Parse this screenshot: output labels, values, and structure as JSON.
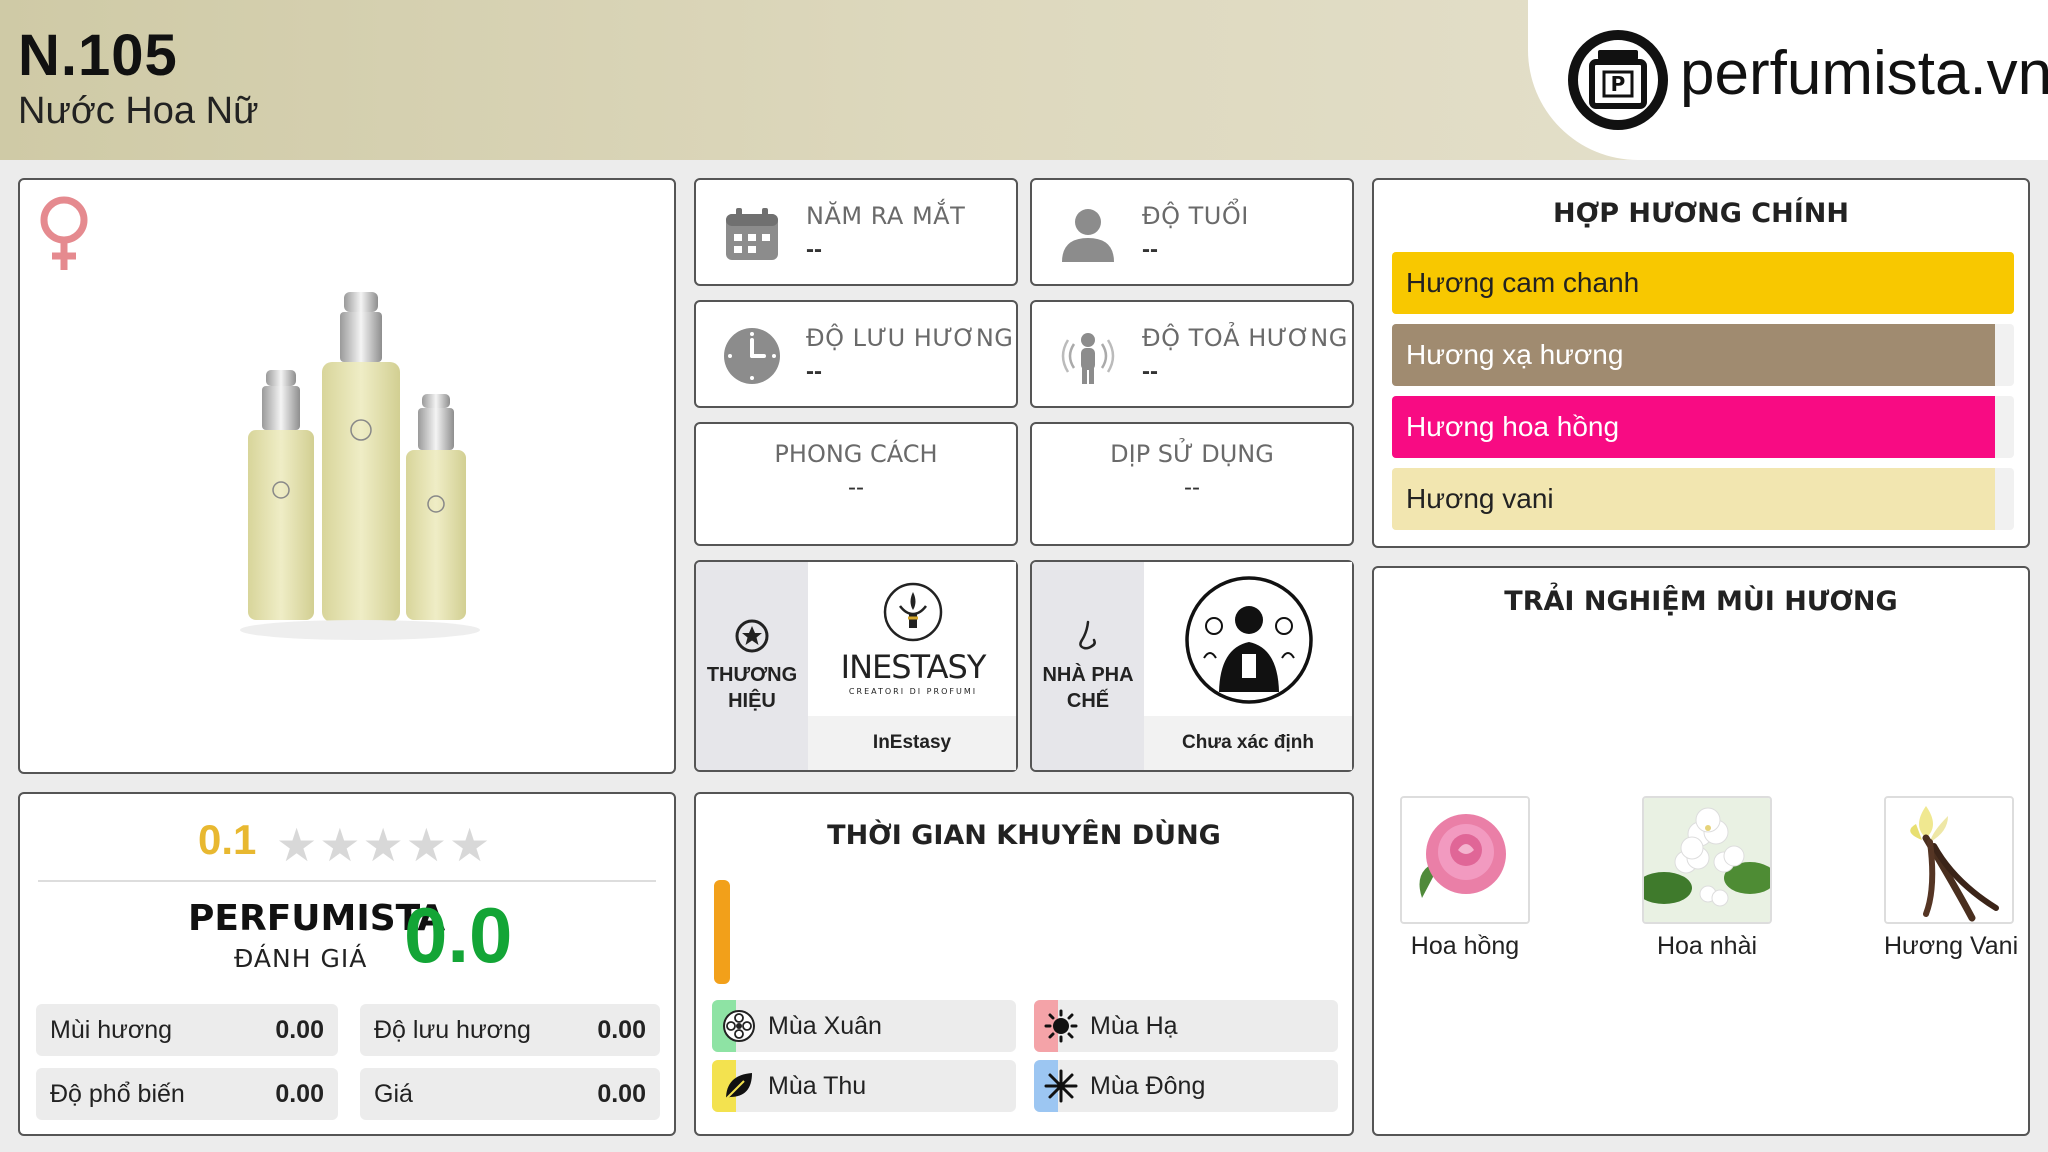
{
  "header": {
    "title": "N.105",
    "subtitle": "Nước Hoa Nữ",
    "logo_text": "perfumista.vn",
    "logo_icon": "perfume-bottle-p-icon"
  },
  "product": {
    "gender_icon": "female-symbol-icon",
    "gender_color": "#e58a8f",
    "image_alt": "InEstasy perfume bottles"
  },
  "info": {
    "release_year": {
      "label": "NĂM RA MẮT",
      "value": "--",
      "icon": "calendar-icon"
    },
    "age": {
      "label": "ĐỘ TUỔI",
      "value": "--",
      "icon": "person-icon"
    },
    "longevity": {
      "label": "ĐỘ LƯU HƯƠNG",
      "value": "--",
      "icon": "clock-icon"
    },
    "sillage": {
      "label": "ĐỘ TOẢ HƯƠNG",
      "value": "--",
      "icon": "sillage-person-icon"
    },
    "style": {
      "label": "PHONG CÁCH",
      "value": "--"
    },
    "occasion": {
      "label": "DỊP SỬ DỤNG",
      "value": "--"
    }
  },
  "brand": {
    "label": "THƯƠNG HIỆU",
    "name": "InEstasy",
    "logo_text": "INESTASY",
    "logo_sub": "CREATORI DI PROFUMI"
  },
  "perfumer": {
    "label": "NHÀ PHA CHẾ",
    "name": "Chưa xác định"
  },
  "accords": {
    "title": "HỢP HƯƠNG CHÍNH",
    "items": [
      {
        "label": "Hương cam chanh",
        "color": "#f8c800",
        "text_color": "#222222",
        "level": 1.0
      },
      {
        "label": "Hương xạ hương",
        "color": "#a08b70",
        "text_color": "#ffffff",
        "level": 0.97
      },
      {
        "label": "Hương hoa hồng",
        "color": "#f80b83",
        "text_color": "#ffffff",
        "level": 0.97
      },
      {
        "label": "Hương vani",
        "color": "#f2e6b0",
        "text_color": "#222222",
        "level": 0.97
      }
    ]
  },
  "experience": {
    "title": "TRẢI NGHIỆM MÙI HƯƠNG",
    "items": [
      {
        "label": "Hoa hồng",
        "icon": "rose-image"
      },
      {
        "label": "Hoa nhài",
        "icon": "jasmine-image"
      },
      {
        "label": "Hương Vani",
        "icon": "vanilla-image"
      }
    ]
  },
  "rating": {
    "stars_value": "0.1",
    "stars_count": 5,
    "brand_label": "PERFUMISTA",
    "sub_label": "ĐÁNH GIÁ",
    "score": "0.0",
    "details": [
      {
        "key": "Mùi hương",
        "value": "0.00"
      },
      {
        "key": "Độ lưu hương",
        "value": "0.00"
      },
      {
        "key": "Độ phổ biến",
        "value": "0.00"
      },
      {
        "key": "Giá",
        "value": "0.00"
      }
    ]
  },
  "seasons": {
    "title": "THỜI GIAN KHUYÊN DÙNG",
    "bar_level": 1.0,
    "bar_color": "#f2a01a",
    "items": [
      {
        "label": "Mùa Xuân",
        "icon": "spring-flower-icon",
        "color": "#8ee3a4"
      },
      {
        "label": "Mùa Hạ",
        "icon": "summer-sun-icon",
        "color": "#f4a3a8"
      },
      {
        "label": "Mùa Thu",
        "icon": "autumn-leaf-icon",
        "color": "#f3e24f"
      },
      {
        "label": "Mùa Đông",
        "icon": "winter-snowflake-icon",
        "color": "#9cc6f2"
      }
    ]
  }
}
